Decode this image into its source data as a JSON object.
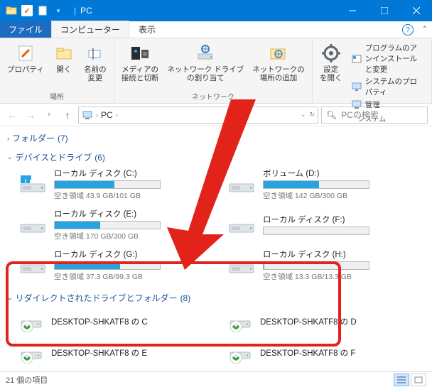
{
  "title": "PC",
  "tabs": {
    "file": "ファイル",
    "computer": "コンピューター",
    "view": "表示"
  },
  "ribbon": {
    "groups": {
      "location": {
        "name": "場所",
        "property": "プロパティ",
        "open": "開く",
        "rename": "名前の\n変更"
      },
      "network": {
        "name": "ネットワーク",
        "media": "メディアの\n接続と切断",
        "netdrive": "ネットワーク ドライブ\nの割り当て",
        "addloc": "ネットワークの\n場所の追加"
      },
      "system": {
        "name": "システム",
        "settings": "設定\nを開く",
        "uninstall": "プログラムのアンインストールと変更",
        "sysprop": "システムのプロパティ",
        "manage": "管理"
      }
    }
  },
  "address": {
    "pc": "PC",
    "search_placeholder": "PCの検索"
  },
  "groups": {
    "folders": {
      "label": "フォルダー",
      "count": "(7)"
    },
    "devices": {
      "label": "デバイスとドライブ",
      "count": "(6)"
    },
    "redirected": {
      "label": "リダイレクトされたドライブとフォルダー",
      "count": "(8)"
    }
  },
  "drives": [
    {
      "name": "ローカル ディスク (C:)",
      "free": "空き領域 43.9 GB/101 GB",
      "pct": 57,
      "os": true
    },
    {
      "name": "ボリューム (D:)",
      "free": "空き領域 142 GB/300 GB",
      "pct": 53,
      "os": false
    },
    {
      "name": "ローカル ディスク (E:)",
      "free": "空き領域 170 GB/300 GB",
      "pct": 43,
      "os": false
    },
    {
      "name": "ローカル ディスク (F:)",
      "free": "",
      "pct": 0,
      "os": false
    },
    {
      "name": "ローカル ディスク (G:)",
      "free": "空き領域 37.3 GB/99.3 GB",
      "pct": 62,
      "os": false
    },
    {
      "name": "ローカル ディスク (H:)",
      "free": "空き領域 13.3 GB/13.3 GB",
      "pct": 1,
      "os": false
    }
  ],
  "redirected": [
    {
      "name": "DESKTOP-SHKATF8 の C"
    },
    {
      "name": "DESKTOP-SHKATF8 の D"
    },
    {
      "name": "DESKTOP-SHKATF8 の E"
    },
    {
      "name": "DESKTOP-SHKATF8 の F"
    }
  ],
  "status": "21 個の項目"
}
